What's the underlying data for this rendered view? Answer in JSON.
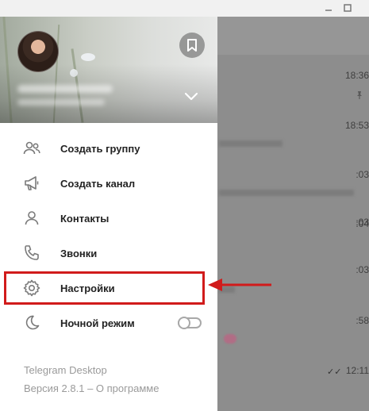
{
  "window": {
    "minimize_icon": "minimize-icon",
    "maximize_icon": "maximize-icon"
  },
  "drawer": {
    "menu_items": [
      {
        "label": "Создать группу",
        "icon": "group-icon"
      },
      {
        "label": "Создать канал",
        "icon": "megaphone-icon"
      },
      {
        "label": "Контакты",
        "icon": "person-icon"
      },
      {
        "label": "Звонки",
        "icon": "phone-icon"
      },
      {
        "label": "Настройки",
        "icon": "gear-icon"
      },
      {
        "label": "Ночной режим",
        "icon": "moon-icon"
      }
    ],
    "night_mode_enabled": false,
    "footer": {
      "app_name": "Telegram Desktop",
      "version": "Версия 2.8.1 – О программе"
    }
  },
  "chat_list": {
    "times": [
      "18:36",
      "18:53",
      ":03",
      ":03",
      ":04",
      ":03",
      ":58",
      "12:11"
    ]
  },
  "colors": {
    "highlight": "#d11b1b",
    "overlay": "#8d8d8d"
  }
}
